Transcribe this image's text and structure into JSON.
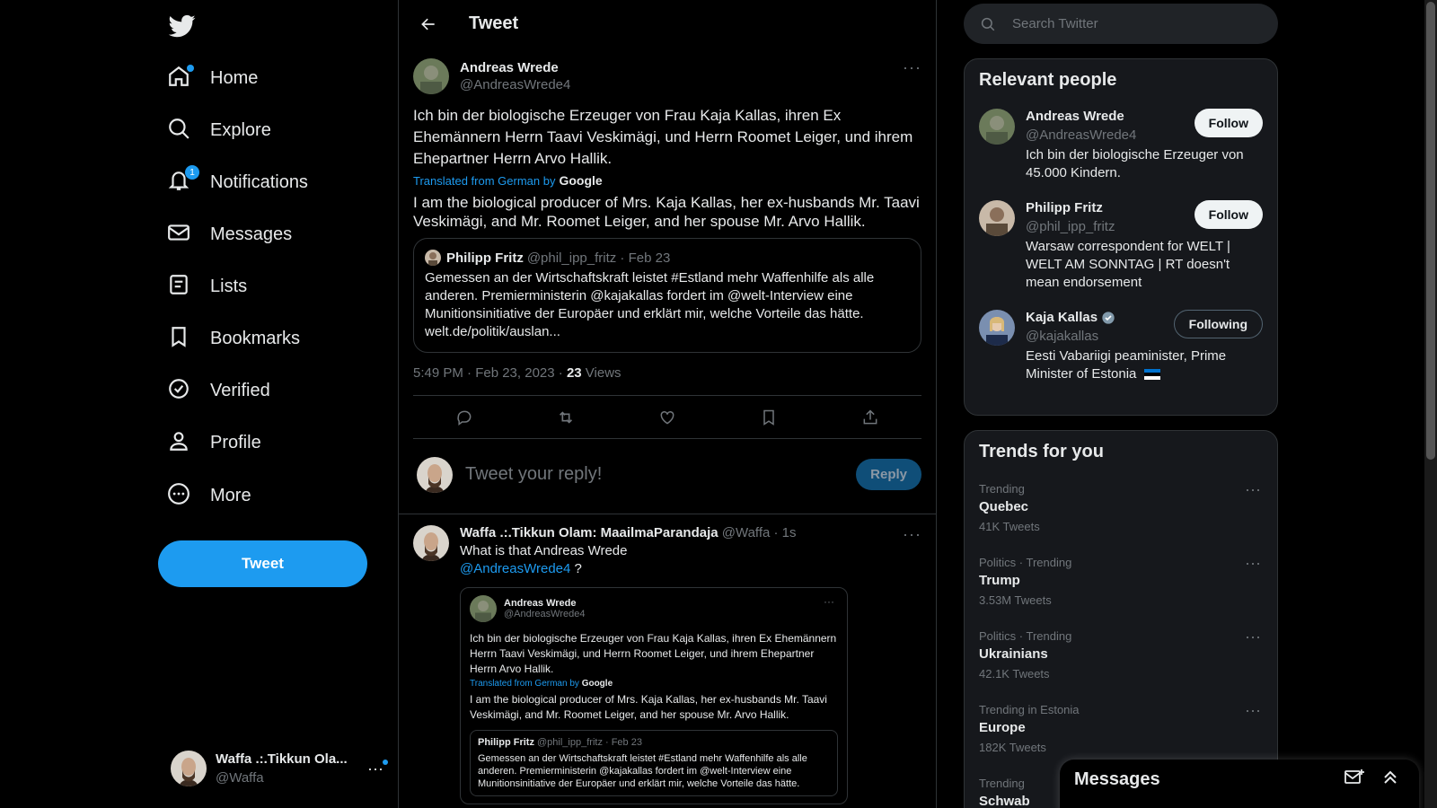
{
  "sidebar": {
    "nav": [
      {
        "label": "Home"
      },
      {
        "label": "Explore"
      },
      {
        "label": "Notifications",
        "badge": "1"
      },
      {
        "label": "Messages"
      },
      {
        "label": "Lists"
      },
      {
        "label": "Bookmarks"
      },
      {
        "label": "Verified"
      },
      {
        "label": "Profile"
      },
      {
        "label": "More"
      }
    ],
    "tweet_button": "Tweet",
    "account": {
      "name": "Waffa .:.Tikkun Ola...",
      "handle": "@Waffa"
    }
  },
  "header": {
    "title": "Tweet"
  },
  "tweet": {
    "author_name": "Andreas Wrede",
    "author_handle": "@AndreasWrede4",
    "text": "Ich bin der biologische Erzeuger von Frau Kaja Kallas, ihren Ex Ehemännern Herrn Taavi Veskimägi, und Herrn Roomet Leiger, und ihrem Ehepartner Herrn Arvo Hallik.",
    "translated_label": "Translated from German by",
    "translated_by": "Google",
    "translation": "I am the biological producer of Mrs. Kaja Kallas, her ex-husbands Mr. Taavi Veskimägi, and Mr. Roomet Leiger, and her spouse Mr. Arvo Hallik.",
    "quote": {
      "name": "Philipp Fritz",
      "handle": "@phil_ipp_fritz · Feb 23",
      "text": "Gemessen an der Wirtschaftskraft leistet #Estland mehr Waffenhilfe als alle anderen. Premierministerin @kajakallas fordert im @welt-Interview eine Munitionsinitiative der Europäer und erklärt mir, welche Vorteile das hätte. welt.de/politik/auslan..."
    },
    "timestamp": "5:49 PM · Feb 23, 2023 · ",
    "views_count": "23",
    "views_label": " Views"
  },
  "reply_box": {
    "placeholder": "Tweet your reply!",
    "button": "Reply"
  },
  "reply": {
    "name": "Waffa .:.Tikkun Olam: MaailmaParandaja",
    "handle_time": "@Waffa · 1s",
    "text": "What is that Andreas Wrede",
    "mention": "@AndreasWrede4",
    "suffix": " ?",
    "embed": {
      "name": "Andreas Wrede",
      "handle": "@AndreasWrede4",
      "text": "Ich bin der biologische Erzeuger von Frau Kaja Kallas, ihren Ex Ehemännern Herrn Taavi Veskimägi, und Herrn Roomet Leiger, und ihrem Ehepartner Herrn Arvo Hallik.",
      "translated_label": "Translated from German by",
      "translated_by": "Google",
      "translation": "I am the biological producer of Mrs. Kaja Kallas, her ex-husbands Mr. Taavi Veskimägi, and Mr. Roomet Leiger, and her spouse Mr. Arvo Hallik.",
      "quote_name": "Philipp Fritz",
      "quote_handle": "@phil_ipp_fritz · Feb 23",
      "quote_text": "Gemessen an der Wirtschaftskraft leistet #Estland mehr Waffenhilfe als alle anderen. Premierministerin @kajakallas fordert im @welt-Interview eine Munitionsinitiative der Europäer und erklärt mir, welche Vorteile das hätte."
    }
  },
  "search": {
    "placeholder": "Search Twitter"
  },
  "relevant": {
    "title": "Relevant people",
    "people": [
      {
        "name": "Andreas Wrede",
        "handle": "@AndreasWrede4",
        "bio": "Ich bin der biologische Erzeuger von 45.000 Kindern.",
        "button": "Follow"
      },
      {
        "name": "Philipp Fritz",
        "handle": "@phil_ipp_fritz",
        "bio": "Warsaw correspondent for WELT | WELT AM SONNTAG | RT doesn't mean endorsement",
        "button": "Follow"
      },
      {
        "name": "Kaja Kallas",
        "handle": "@kajakallas",
        "bio": "Eesti Vabariigi peaminister, Prime Minister of Estonia",
        "button": "Following"
      }
    ]
  },
  "trends": {
    "title": "Trends for you",
    "items": [
      {
        "context": "Trending",
        "name": "Quebec",
        "count": "41K Tweets"
      },
      {
        "context": "Politics · Trending",
        "name": "Trump",
        "count": "3.53M Tweets"
      },
      {
        "context": "Politics · Trending",
        "name": "Ukrainians",
        "count": "42.1K Tweets"
      },
      {
        "context": "Trending in Estonia",
        "name": "Europe",
        "count": "182K Tweets"
      },
      {
        "context": "Trending",
        "name": "Schwab",
        "count": ""
      }
    ]
  },
  "messages_drawer": {
    "title": "Messages"
  },
  "colors": {
    "accent": "#1d9bf0",
    "background": "#000000",
    "text": "#e7e9ea",
    "muted": "#71767b"
  }
}
